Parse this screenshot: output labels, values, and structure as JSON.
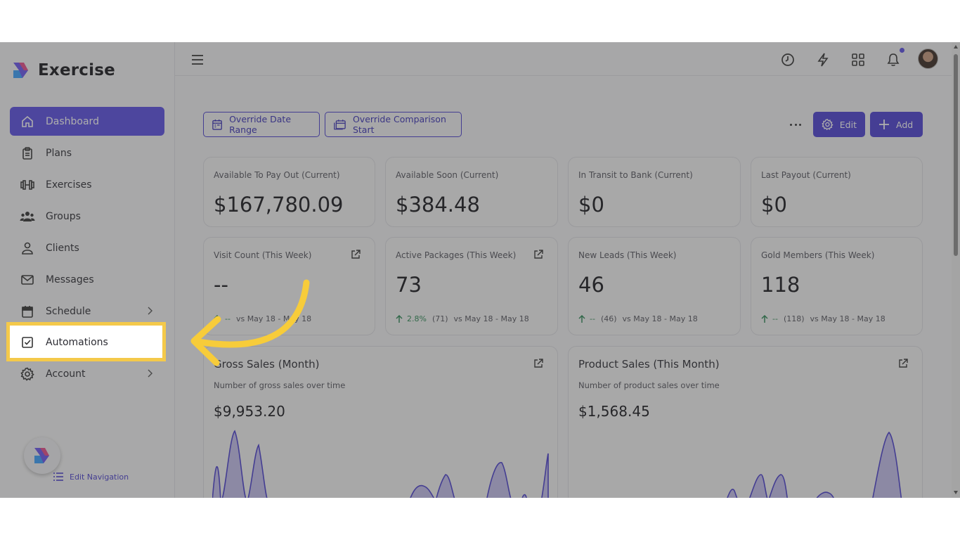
{
  "app": {
    "name": "Exercise"
  },
  "sidebar": {
    "items": [
      {
        "label": "Dashboard",
        "icon": "home-icon",
        "active": true
      },
      {
        "label": "Plans",
        "icon": "clipboard-icon"
      },
      {
        "label": "Exercises",
        "icon": "dumbbell-icon"
      },
      {
        "label": "Groups",
        "icon": "users-icon"
      },
      {
        "label": "Clients",
        "icon": "user-icon"
      },
      {
        "label": "Messages",
        "icon": "mail-icon"
      },
      {
        "label": "Schedule",
        "icon": "calendar-icon",
        "has_submenu": true
      },
      {
        "label": "Automations",
        "icon": "checkbox-icon",
        "highlighted": true
      },
      {
        "label": "Account",
        "icon": "gear-icon",
        "has_submenu": true
      }
    ],
    "edit_navigation_label": "Edit Navigation"
  },
  "topbar": {
    "icons": [
      "menu-icon",
      "clock-icon",
      "lightning-icon",
      "grid-icon",
      "bell-icon"
    ],
    "has_notification": true
  },
  "toolbar": {
    "override_date_range": "Override Date Range",
    "override_comparison_start": "Override Comparison Start",
    "edit_label": "Edit",
    "add_label": "Add"
  },
  "stat_cards": [
    {
      "title": "Available To Pay Out (Current)",
      "value": "$167,780.09"
    },
    {
      "title": "Available Soon (Current)",
      "value": "$384.48"
    },
    {
      "title": "In Transit to Bank (Current)",
      "value": "$0"
    },
    {
      "title": "Last Payout (Current)",
      "value": "$0"
    }
  ],
  "weekly_cards": [
    {
      "title": "Visit Count (This Week)",
      "value": "--",
      "pct": "--",
      "paren": "",
      "vs": "vs May 18 - May 18",
      "external": true
    },
    {
      "title": "Active Packages (This Week)",
      "value": "73",
      "pct": "2.8%",
      "paren": "(71)",
      "vs": "vs May 18 - May 18",
      "external": true
    },
    {
      "title": "New Leads (This Week)",
      "value": "46",
      "pct": "--",
      "paren": "(46)",
      "vs": "vs May 18 - May 18",
      "external": false
    },
    {
      "title": "Gold Members (This Week)",
      "value": "118",
      "pct": "--",
      "paren": "(118)",
      "vs": "vs May 18 - May 18",
      "external": false
    }
  ],
  "chart_cards": [
    {
      "title": "Gross Sales (Month)",
      "subtitle": "Number of gross sales over time",
      "value": "$9,953.20"
    },
    {
      "title": "Product Sales (This Month)",
      "subtitle": "Number of product sales over time",
      "value": "$1,568.45"
    }
  ],
  "colors": {
    "accent": "#5b4ee6",
    "highlight": "#f4c94a",
    "positive": "#2d8a55"
  }
}
